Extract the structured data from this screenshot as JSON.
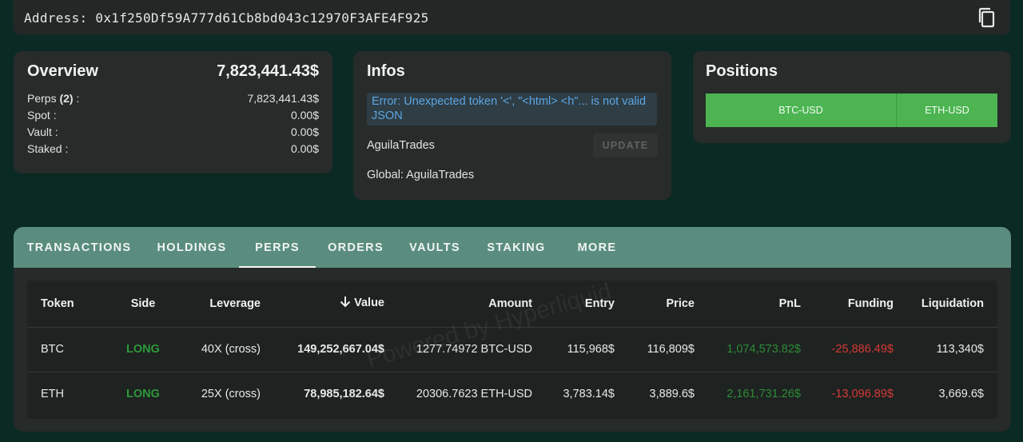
{
  "address_bar": {
    "text": "Address: 0x1f250Df59A777d61Cb8bd043c12970F3AFE4F925",
    "copy_icon": "copy-icon"
  },
  "overview": {
    "title": "Overview",
    "total": "7,823,441.43$",
    "rows": [
      {
        "label": "Perps",
        "count": "(2)",
        "suffix": " :",
        "value": "7,823,441.43$"
      },
      {
        "label": "Spot :",
        "value": "0.00$"
      },
      {
        "label": "Vault :",
        "value": "0.00$"
      },
      {
        "label": "Staked :",
        "value": "0.00$"
      }
    ]
  },
  "infos": {
    "title": "Infos",
    "error": "Error: Unexpected token '<', \"<html> <h\"... is not valid JSON",
    "name": "AguilaTrades",
    "update_label": "UPDATE",
    "global": "Global: AguilaTrades"
  },
  "positions": {
    "title": "Positions",
    "tabs": [
      "BTC-USD",
      "ETH-USD"
    ],
    "accent": "#4cb551"
  },
  "tabs": {
    "items": [
      "TRANSACTIONS",
      "HOLDINGS",
      "PERPS",
      "ORDERS",
      "VAULTS",
      "STAKING",
      "MORE"
    ],
    "active": "PERPS",
    "bar_color": "#5a8d7e"
  },
  "table": {
    "headers": {
      "token": "Token",
      "side": "Side",
      "leverage": "Leverage",
      "value": "Value",
      "amount": "Amount",
      "entry": "Entry",
      "price": "Price",
      "pnl": "PnL",
      "funding": "Funding",
      "liquidation": "Liquidation"
    },
    "sort_icon": "arrow-down-icon",
    "rows": [
      {
        "token": "BTC",
        "side": "LONG",
        "leverage": "40X (cross)",
        "value": "149,252,667.04$",
        "amount": "1277.74972 BTC-USD",
        "entry": "115,968$",
        "price": "116,809$",
        "pnl": "1,074,573.82$",
        "funding": "-25,886.49$",
        "liquidation": "113,340$"
      },
      {
        "token": "ETH",
        "side": "LONG",
        "leverage": "25X (cross)",
        "value": "78,985,182.64$",
        "amount": "20306.7623 ETH-USD",
        "entry": "3,783.14$",
        "price": "3,889.6$",
        "pnl": "2,161,731.26$",
        "funding": "-13,096.89$",
        "liquidation": "3,669.6$"
      }
    ]
  },
  "watermark": "Powered by Hyperliquid",
  "colors": {
    "long": "#2d9a38",
    "pnl_positive": "#2e8b36",
    "funding_negative": "#d63a34",
    "error": "#5aa7e6"
  }
}
